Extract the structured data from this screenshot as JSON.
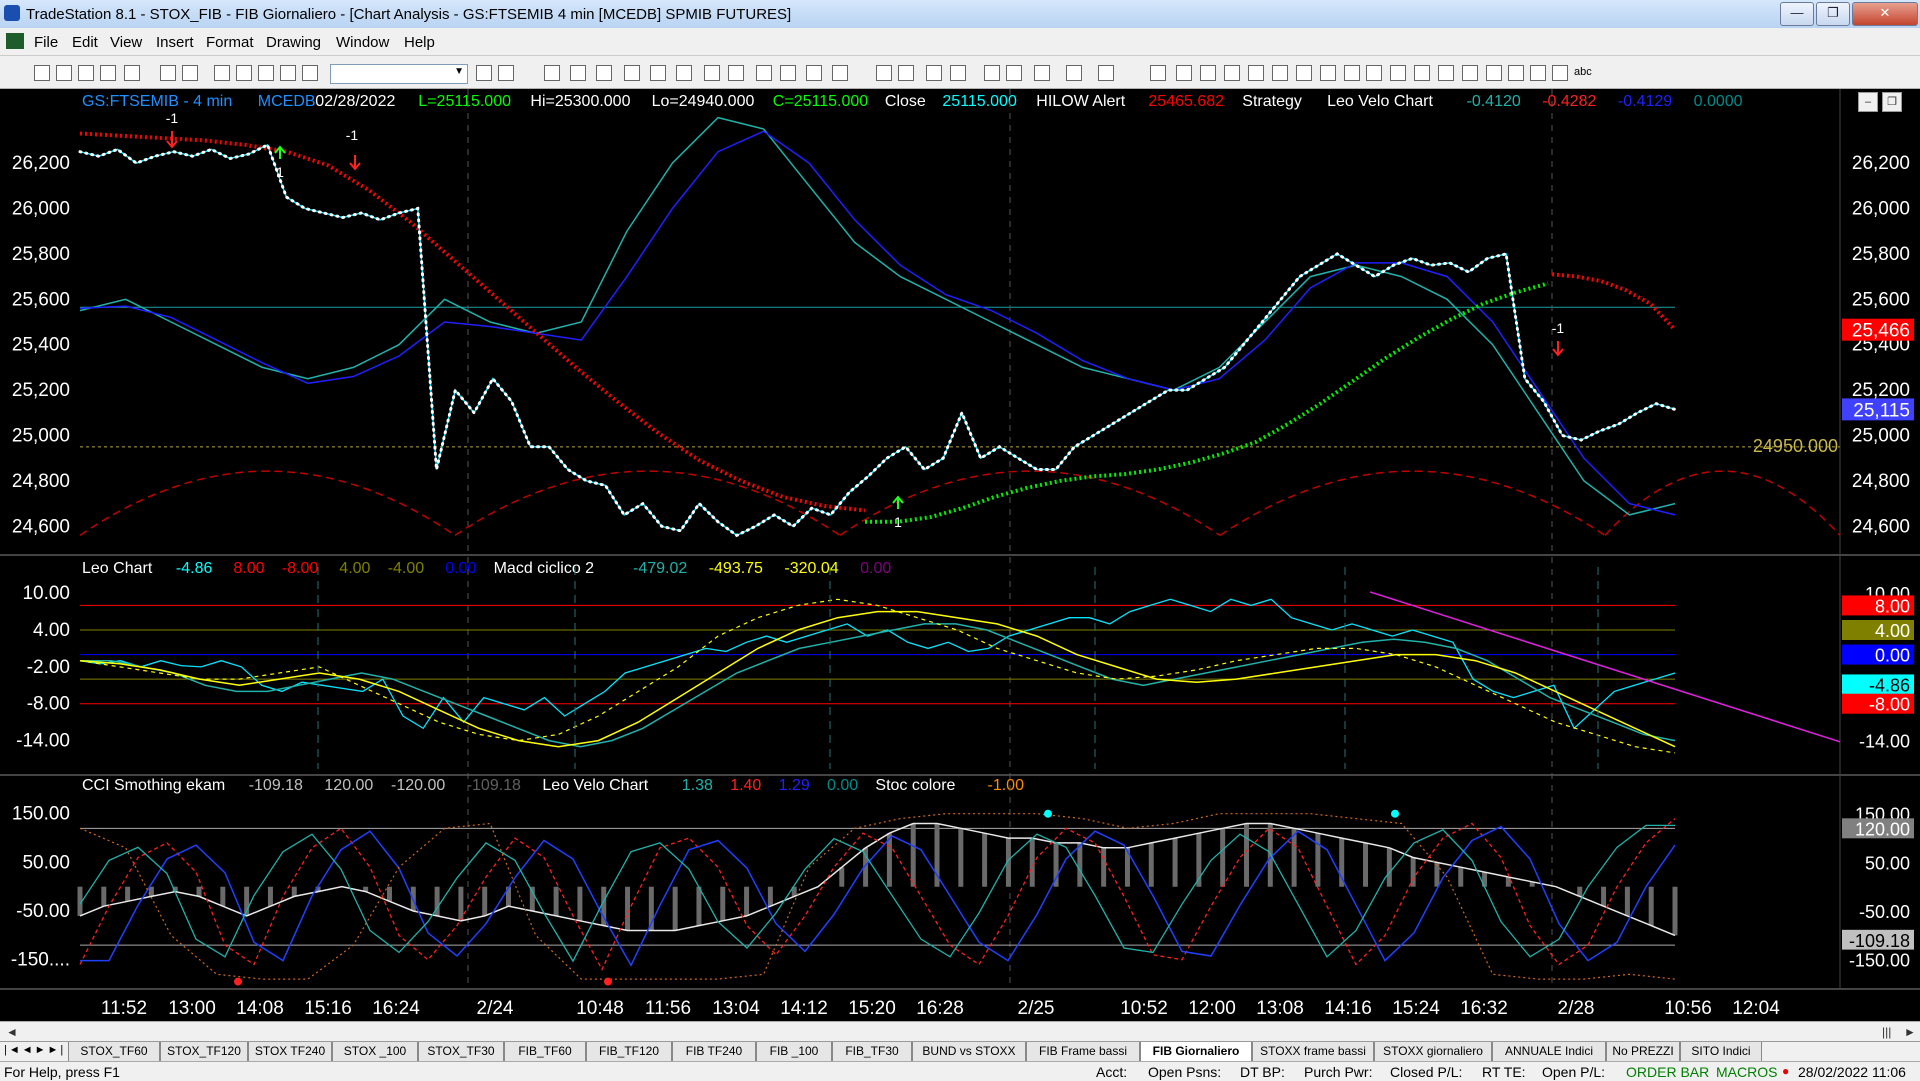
{
  "window": {
    "title": "TradeStation 8.1 - STOX_FIB - FIB Giornaliero - [Chart Analysis - GS:FTSEMIB  4 min  [MCEDB] SPMIB FUTURES]",
    "minimize_glyph": "—",
    "maximize_glyph": "❐",
    "close_glyph": "✕"
  },
  "menu": {
    "items": [
      "File",
      "Edit",
      "View",
      "Insert",
      "Format",
      "Drawing",
      "Window",
      "Help"
    ],
    "mdi_glyphs": [
      "_",
      "❐",
      "✕"
    ]
  },
  "toolbar": {
    "icons": [
      "new-icon",
      "open-icon",
      "save-icon",
      "save-all-icon",
      "print-icon",
      "print-preview-icon",
      "cut-icon",
      "copy-icon",
      "paste-icon",
      "grid-icon",
      "indicator-icon",
      "strategy-icon",
      "zoom-in-icon",
      "zoom-out-icon",
      "cursor-icon",
      "trendline-icon",
      "fib-icon",
      "text-icon"
    ],
    "symbol_value": "",
    "text_tool_label": "abc"
  },
  "price_pane": {
    "header": [
      {
        "text": "GS:FTSEMIB - 4 min",
        "color": "#1e90ff"
      },
      {
        "text": "MCEDB",
        "color": "#1e90ff"
      },
      {
        "text": "02/28/2022",
        "color": "#ffffff"
      },
      {
        "text": "L=25115.000",
        "color": "#00ff00"
      },
      {
        "text": "Hi=25300.000",
        "color": "#ffffff"
      },
      {
        "text": "Lo=24940.000",
        "color": "#ffffff"
      },
      {
        "text": "C=25115.000",
        "color": "#00ff00"
      },
      {
        "text": "Close",
        "color": "#ffffff"
      },
      {
        "text": "25115.000",
        "color": "#00ffff"
      },
      {
        "text": "HILOW Alert",
        "color": "#ffffff"
      },
      {
        "text": "25465.682",
        "color": "#ff0000"
      },
      {
        "text": "Strategy",
        "color": "#ffffff"
      },
      {
        "text": "Leo Velo Chart",
        "color": "#ffffff"
      },
      {
        "text": "-0.4120",
        "color": "#20b2aa"
      },
      {
        "text": "-0.4282",
        "color": "#ff2020"
      },
      {
        "text": "-0.4129",
        "color": "#2020ff"
      },
      {
        "text": "0.0000",
        "color": "#008b8b"
      }
    ],
    "y_ticks": [
      "26,200",
      "26,000",
      "25,800",
      "25,600",
      "25,400",
      "25,200",
      "25,000",
      "24,800",
      "24,600"
    ],
    "y_values": [
      26200,
      26000,
      25800,
      25600,
      25400,
      25200,
      25000,
      24800,
      24600
    ],
    "right_badges": [
      {
        "text": "25,466",
        "bg": "#ff0000",
        "fg": "#ffffff"
      },
      {
        "text": "25,115",
        "bg": "#4040ff",
        "fg": "#ffffff"
      }
    ],
    "level_label": "24950.000",
    "trade_marks": [
      "-1",
      "1",
      "-1",
      "1",
      "-1"
    ]
  },
  "osc_pane": {
    "header": [
      {
        "text": "Leo Chart",
        "color": "#ffffff"
      },
      {
        "text": "-4.86",
        "color": "#00ffff"
      },
      {
        "text": "8.00",
        "color": "#ff0000"
      },
      {
        "text": "-8.00",
        "color": "#ff0000"
      },
      {
        "text": "4.00",
        "color": "#808000"
      },
      {
        "text": "-4.00",
        "color": "#808000"
      },
      {
        "text": "0.00",
        "color": "#0000ff"
      },
      {
        "text": "Macd ciclico 2",
        "color": "#ffffff"
      },
      {
        "text": "-479.02",
        "color": "#20b2aa"
      },
      {
        "text": "-493.75",
        "color": "#ffff00"
      },
      {
        "text": "-320.04",
        "color": "#ffff00"
      },
      {
        "text": "0.00",
        "color": "#800080"
      }
    ],
    "y_ticks": [
      "10.00",
      "4.00",
      "-2.00",
      "-8.00",
      "-14.00"
    ],
    "right_badges": [
      {
        "text": "10.00",
        "bg": "#000000",
        "fg": "#ffffff"
      },
      {
        "text": "8.00",
        "bg": "#ff0000",
        "fg": "#ffffff"
      },
      {
        "text": "4.00",
        "bg": "#808000",
        "fg": "#ffffff"
      },
      {
        "text": "0.00",
        "bg": "#0000ff",
        "fg": "#ffffff"
      },
      {
        "text": "-4.86",
        "bg": "#00ffff",
        "fg": "#000000"
      },
      {
        "text": "-8.00",
        "bg": "#ff0000",
        "fg": "#ffffff"
      },
      {
        "text": "-14.00",
        "bg": "#000000",
        "fg": "#ffffff"
      }
    ]
  },
  "cci_pane": {
    "header": [
      {
        "text": "CCI Smothing ekam",
        "color": "#ffffff"
      },
      {
        "text": "-109.18",
        "color": "#c0c0c0"
      },
      {
        "text": "120.00",
        "color": "#c0c0c0"
      },
      {
        "text": "-120.00",
        "color": "#c0c0c0"
      },
      {
        "text": "-109.18",
        "color": "#606060"
      },
      {
        "text": "Leo Velo Chart",
        "color": "#ffffff"
      },
      {
        "text": "1.38",
        "color": "#20b2aa"
      },
      {
        "text": "1.40",
        "color": "#ff2020"
      },
      {
        "text": "1.29",
        "color": "#2020ff"
      },
      {
        "text": "0.00",
        "color": "#008b8b"
      },
      {
        "text": "Stoc colore",
        "color": "#ffffff"
      },
      {
        "text": "-1.00",
        "color": "#ff8c00"
      }
    ],
    "y_ticks": [
      "150.00",
      "50.00",
      "-50.00",
      "-150...."
    ],
    "right_badges": [
      {
        "text": "150.00",
        "bg": "#000000",
        "fg": "#ffffff"
      },
      {
        "text": "120.00",
        "bg": "#808080",
        "fg": "#ffffff"
      },
      {
        "text": "50.00",
        "bg": "#000000",
        "fg": "#ffffff"
      },
      {
        "text": "-50.00",
        "bg": "#000000",
        "fg": "#ffffff"
      },
      {
        "text": "-109.18",
        "bg": "#c0c0c0",
        "fg": "#000000"
      },
      {
        "text": "-150.00",
        "bg": "#000000",
        "fg": "#ffffff"
      }
    ]
  },
  "x_axis": {
    "labels": [
      "11:52",
      "13:00",
      "14:08",
      "15:16",
      "16:24",
      "2/24",
      "10:48",
      "11:56",
      "13:04",
      "14:12",
      "15:20",
      "16:28",
      "2/25",
      "10:52",
      "12:00",
      "13:08",
      "14:16",
      "15:24",
      "16:32",
      "2/28",
      "10:56",
      "12:04"
    ]
  },
  "chart_data": {
    "type": "line",
    "title": "",
    "symbol": "GS:FTSEMIB",
    "interval": "4 min",
    "ylim": [
      24500,
      26350
    ],
    "level_line": 24950,
    "session_breaks": [
      "2/24",
      "2/25",
      "2/28"
    ],
    "series": [
      {
        "kind": "price-close",
        "color": "#00e5ff",
        "values": [
          26250,
          26230,
          26260,
          26200,
          26230,
          26250,
          26230,
          26260,
          26220,
          26240,
          26280,
          26050,
          26000,
          25980,
          25960,
          25980,
          25950,
          25980,
          26000,
          24850,
          25200,
          25100,
          25250,
          25150,
          24950,
          24950,
          24850,
          24800,
          24780,
          24650,
          24700,
          24600,
          24580,
          24700,
          24620,
          24560,
          24600,
          24650,
          24600,
          24680,
          24650,
          24750,
          24820,
          24900,
          24950,
          24850,
          24900,
          25100,
          24900,
          24950,
          24900,
          24850,
          24850,
          24950,
          25000,
          25050,
          25100,
          25150,
          25200,
          25200,
          25250,
          25300,
          25400,
          25500,
          25600,
          25700,
          25750,
          25800,
          25750,
          25700,
          25750,
          25780,
          25750,
          25760,
          25720,
          25780,
          25800,
          25250,
          25150,
          25000,
          24980,
          25020,
          25050,
          25100,
          25140,
          25115
        ]
      },
      {
        "kind": "hilow-red",
        "color": "#ff0000",
        "values": [
          26330,
          26320,
          26310,
          26300,
          26280,
          26250,
          26190,
          26080,
          25940,
          25780,
          25620,
          25460,
          25300,
          25150,
          25010,
          24890,
          24800,
          24730,
          24690,
          24670
        ]
      },
      {
        "kind": "hilow-green",
        "color": "#00ee00",
        "values": [
          24620,
          24620,
          24640,
          24680,
          24730,
          24770,
          24800,
          24820,
          24830,
          24850,
          24880,
          24920,
          24970,
          25050,
          25140,
          25240,
          25340,
          25430,
          25510,
          25580,
          25630,
          25670
        ]
      },
      {
        "kind": "hilow-red-late",
        "color": "#ff0000",
        "values": [
          25710,
          25700,
          25680,
          25640,
          25580,
          25466
        ]
      },
      {
        "kind": "leo-velo-teal",
        "color": "#20b2aa",
        "values": [
          25550,
          25600,
          25500,
          25400,
          25300,
          25250,
          25300,
          25400,
          25600,
          25500,
          25450,
          25500,
          25900,
          26200,
          26400,
          26350,
          26100,
          25850,
          25700,
          25600,
          25500,
          25400,
          25300,
          25250,
          25200,
          25300,
          25500,
          25700,
          25750,
          25700,
          25600,
          25400,
          25100,
          24800,
          24650,
          24700
        ]
      },
      {
        "kind": "leo-velo-blue",
        "color": "#2020ff",
        "values": [
          25560,
          25570,
          25520,
          25420,
          25320,
          25230,
          25260,
          25350,
          25500,
          25480,
          25450,
          25420,
          25700,
          26000,
          26250,
          26340,
          26200,
          25950,
          25750,
          25620,
          25550,
          25450,
          25330,
          25250,
          25200,
          25250,
          25420,
          25650,
          25760,
          25760,
          25700,
          25500,
          25200,
          24900,
          24700,
          24650
        ]
      }
    ]
  }
}
